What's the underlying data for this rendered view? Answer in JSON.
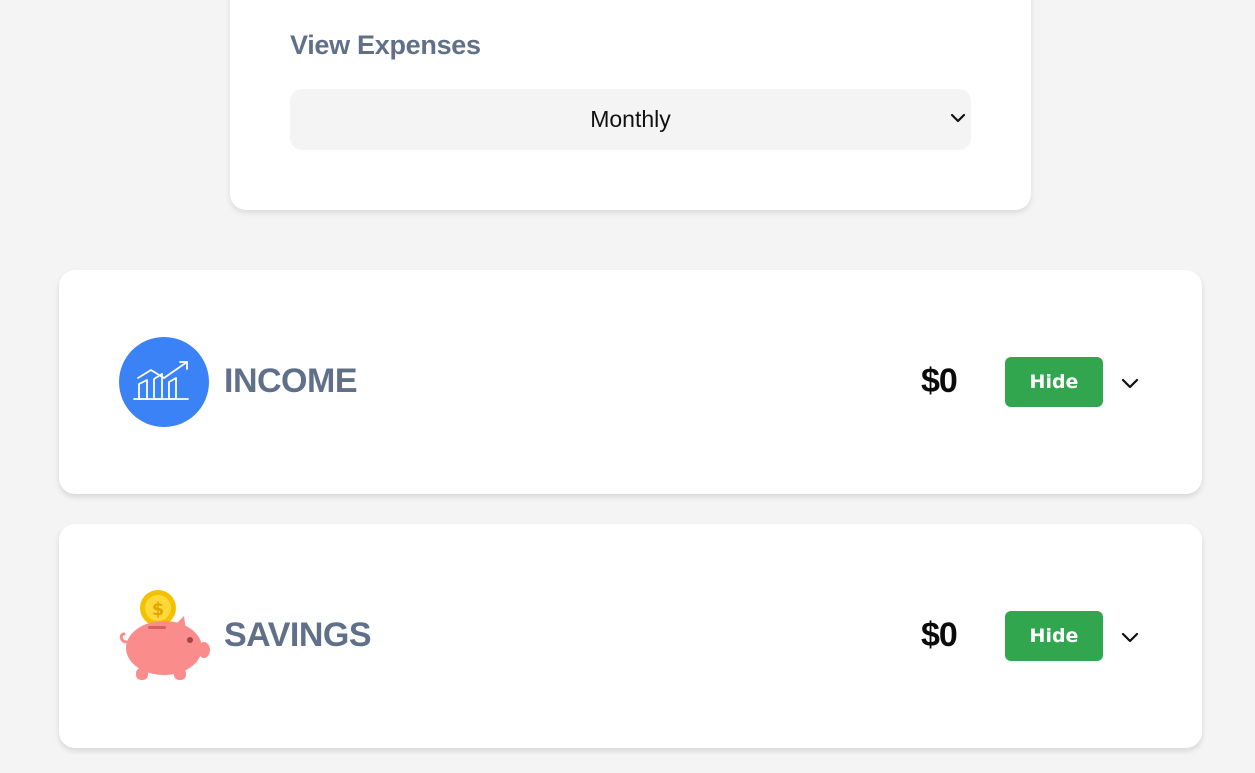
{
  "view_expenses": {
    "title": "View Expenses",
    "period_selected": "Monthly",
    "chevron_icon": "chevron-down-icon"
  },
  "categories": [
    {
      "label": "INCOME",
      "amount": "$0",
      "button_label": "Hide",
      "icon": "income-chart-icon",
      "icon_color": "#3b82f6"
    },
    {
      "label": "SAVINGS",
      "amount": "$0",
      "button_label": "Hide",
      "icon": "piggy-bank-icon",
      "icon_color": "#fb8c8c"
    }
  ],
  "colors": {
    "background": "#f4f4f4",
    "card": "#ffffff",
    "label": "#607088",
    "button": "#31a64f"
  }
}
